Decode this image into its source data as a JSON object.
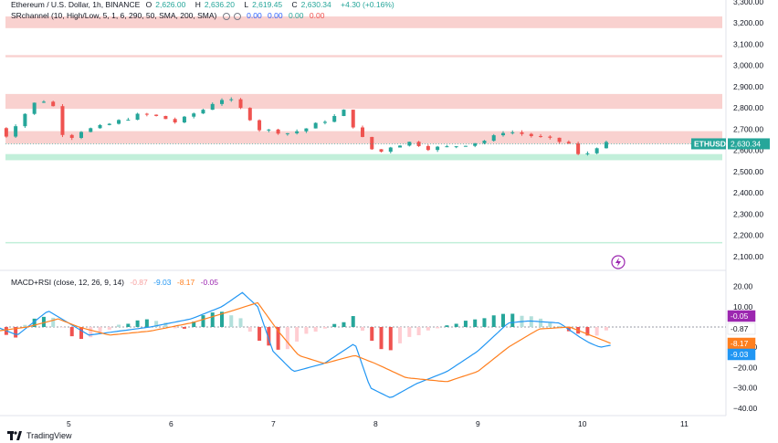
{
  "colors": {
    "up": "#26a69a",
    "down": "#ef5350",
    "res_zone": "#f8c9c7",
    "sup_zone": "#b7ecd3",
    "macd": "#2196f3",
    "signal": "#ff7f1e",
    "rsi_tag": "#9c27b0",
    "price_tag": "#26a69a"
  },
  "header": {
    "symbol_line": "Ethereum / U.S. Dollar, 1h, BINANCE",
    "o_label": "O",
    "o_value": "2,626.00",
    "h_label": "H",
    "h_value": "2,636.20",
    "l_label": "L",
    "l_value": "2,619.45",
    "c_label": "C",
    "c_value": "2,630.34",
    "change": "+4.30 (+0.16%)",
    "indicator_line": "SRchannel (10, High/Low, 5, 1, 6, 290, 50, SMA, 200, SMA)",
    "indicator_values": [
      "0.00",
      "0.00",
      "0.00",
      "0.00"
    ]
  },
  "macd_header": {
    "label": "MACD+RSI (close, 12, 26, 9, 14)",
    "v1": "-0.87",
    "v2": "-9.03",
    "v3": "-8.17",
    "v4": "-0.05"
  },
  "footer": {
    "brand": "TradingView"
  },
  "chart_data": [
    {
      "type": "candlestick",
      "symbol": "ETHUSD",
      "last_price": "2,630.34",
      "y_ticks": [
        "3,300.00",
        "3,200.00",
        "3,100.00",
        "3,000.00",
        "2,900.00",
        "2,800.00",
        "2,700.00",
        "2,600.00",
        "2,500.00",
        "2,400.00",
        "2,300.00",
        "2,200.00",
        "2,100.00"
      ],
      "y_tick_values": [
        3300,
        3200,
        3100,
        3000,
        2900,
        2800,
        2700,
        2600,
        2500,
        2400,
        2300,
        2200,
        2100
      ],
      "x_ticks": [
        "5",
        "6",
        "7",
        "8",
        "9",
        "10",
        "11"
      ],
      "zones": [
        {
          "kind": "resistance",
          "from": 3175,
          "to": 3230
        },
        {
          "kind": "resistance",
          "from": 3038,
          "to": 3048
        },
        {
          "kind": "resistance",
          "from": 2795,
          "to": 2865
        },
        {
          "kind": "resistance",
          "from": 2630,
          "to": 2690
        },
        {
          "kind": "support",
          "from": 2553,
          "to": 2582
        },
        {
          "kind": "support",
          "from": 2164,
          "to": 2168
        }
      ],
      "price_path": [
        [
          4.3,
          2790
        ],
        [
          4.45,
          2650
        ],
        [
          4.6,
          2735
        ],
        [
          4.75,
          2820
        ],
        [
          4.9,
          2840
        ],
        [
          5.0,
          2760
        ],
        [
          5.05,
          2640
        ],
        [
          5.2,
          2690
        ],
        [
          5.4,
          2710
        ],
        [
          5.6,
          2740
        ],
        [
          5.8,
          2770
        ],
        [
          6.0,
          2755
        ],
        [
          6.15,
          2730
        ],
        [
          6.3,
          2770
        ],
        [
          6.45,
          2800
        ],
        [
          6.55,
          2845
        ],
        [
          6.7,
          2830
        ],
        [
          6.85,
          2760
        ],
        [
          6.95,
          2700
        ],
        [
          7.1,
          2690
        ],
        [
          7.25,
          2680
        ],
        [
          7.4,
          2700
        ],
        [
          7.55,
          2730
        ],
        [
          7.7,
          2760
        ],
        [
          7.8,
          2790
        ],
        [
          7.9,
          2690
        ],
        [
          8.0,
          2640
        ],
        [
          8.1,
          2580
        ],
        [
          8.25,
          2620
        ],
        [
          8.45,
          2640
        ],
        [
          8.6,
          2610
        ],
        [
          8.8,
          2615
        ],
        [
          9.0,
          2630
        ],
        [
          9.2,
          2650
        ],
        [
          9.35,
          2690
        ],
        [
          9.5,
          2680
        ],
        [
          9.7,
          2660
        ],
        [
          9.9,
          2640
        ],
        [
          10.0,
          2630
        ],
        [
          10.1,
          2560
        ],
        [
          10.2,
          2600
        ],
        [
          10.3,
          2630
        ]
      ]
    },
    {
      "type": "line",
      "title": "MACD+RSI (close, 12, 26, 9, 14)",
      "y_ticks": [
        "20.00",
        "10.00",
        "0.00",
        "−10.00",
        "−20.00",
        "−30.00",
        "−40.00"
      ],
      "y_tick_values": [
        20,
        10,
        0,
        -10,
        -20,
        -30,
        -40
      ],
      "last_values": {
        "rsi_tag": "-0.05",
        "hist_tag": "-0.87",
        "signal_tag": "-8.17",
        "macd_tag": "-9.03"
      },
      "series": [
        {
          "key": "macd",
          "values": [
            [
              4.3,
              0
            ],
            [
              4.5,
              -4
            ],
            [
              4.8,
              8
            ],
            [
              5.0,
              2
            ],
            [
              5.2,
              -4
            ],
            [
              5.5,
              -2
            ],
            [
              5.8,
              0
            ],
            [
              6.2,
              4
            ],
            [
              6.5,
              10
            ],
            [
              6.7,
              17
            ],
            [
              6.85,
              10
            ],
            [
              7.0,
              -12
            ],
            [
              7.2,
              -22
            ],
            [
              7.5,
              -18
            ],
            [
              7.8,
              -8
            ],
            [
              7.95,
              -30
            ],
            [
              8.15,
              -35
            ],
            [
              8.4,
              -28
            ],
            [
              8.7,
              -22
            ],
            [
              9.0,
              -12
            ],
            [
              9.3,
              2
            ],
            [
              9.5,
              3
            ],
            [
              9.8,
              2
            ],
            [
              10.0,
              -5
            ],
            [
              10.1,
              -8
            ],
            [
              10.2,
              -10
            ],
            [
              10.3,
              -9
            ]
          ]
        },
        {
          "key": "signal",
          "values": [
            [
              4.3,
              -2
            ],
            [
              4.6,
              0
            ],
            [
              4.9,
              4
            ],
            [
              5.1,
              0
            ],
            [
              5.4,
              -4
            ],
            [
              5.8,
              -2
            ],
            [
              6.2,
              2
            ],
            [
              6.6,
              8
            ],
            [
              6.85,
              12
            ],
            [
              7.05,
              -2
            ],
            [
              7.25,
              -14
            ],
            [
              7.5,
              -18
            ],
            [
              7.8,
              -14
            ],
            [
              8.0,
              -18
            ],
            [
              8.3,
              -25
            ],
            [
              8.7,
              -27
            ],
            [
              9.0,
              -22
            ],
            [
              9.3,
              -10
            ],
            [
              9.6,
              -1
            ],
            [
              9.9,
              0
            ],
            [
              10.1,
              -4
            ],
            [
              10.3,
              -8
            ]
          ]
        },
        {
          "key": "hist",
          "values": [
            [
              4.3,
              2
            ],
            [
              4.4,
              -4
            ],
            [
              4.5,
              -5
            ],
            [
              4.6,
              3
            ],
            [
              4.7,
              5
            ],
            [
              4.8,
              6
            ],
            [
              4.9,
              2
            ],
            [
              5.0,
              -3
            ],
            [
              5.1,
              -6
            ],
            [
              5.2,
              -5
            ],
            [
              5.3,
              -3
            ],
            [
              5.4,
              -1
            ],
            [
              5.5,
              1
            ],
            [
              5.6,
              2
            ],
            [
              5.7,
              3
            ],
            [
              5.8,
              4
            ],
            [
              6.0,
              1
            ],
            [
              6.1,
              -2
            ],
            [
              6.2,
              2
            ],
            [
              6.3,
              5
            ],
            [
              6.4,
              7
            ],
            [
              6.5,
              8
            ],
            [
              6.6,
              6
            ],
            [
              6.7,
              4
            ],
            [
              6.8,
              -4
            ],
            [
              6.9,
              -8
            ],
            [
              7.0,
              -10
            ],
            [
              7.1,
              -12
            ],
            [
              7.2,
              -8
            ],
            [
              7.3,
              -4
            ],
            [
              7.5,
              -1
            ],
            [
              7.7,
              3
            ],
            [
              7.8,
              6
            ],
            [
              7.9,
              -4
            ],
            [
              8.0,
              -8
            ],
            [
              8.1,
              -12
            ],
            [
              8.2,
              -10
            ],
            [
              8.3,
              -6
            ],
            [
              8.5,
              -2
            ],
            [
              8.7,
              1
            ],
            [
              8.9,
              3
            ],
            [
              9.1,
              5
            ],
            [
              9.2,
              6
            ],
            [
              9.4,
              6
            ],
            [
              9.6,
              4
            ],
            [
              9.8,
              1
            ],
            [
              9.9,
              -2
            ],
            [
              10.0,
              -3
            ],
            [
              10.1,
              -5
            ],
            [
              10.2,
              -4
            ],
            [
              10.3,
              -1
            ]
          ]
        }
      ]
    }
  ]
}
